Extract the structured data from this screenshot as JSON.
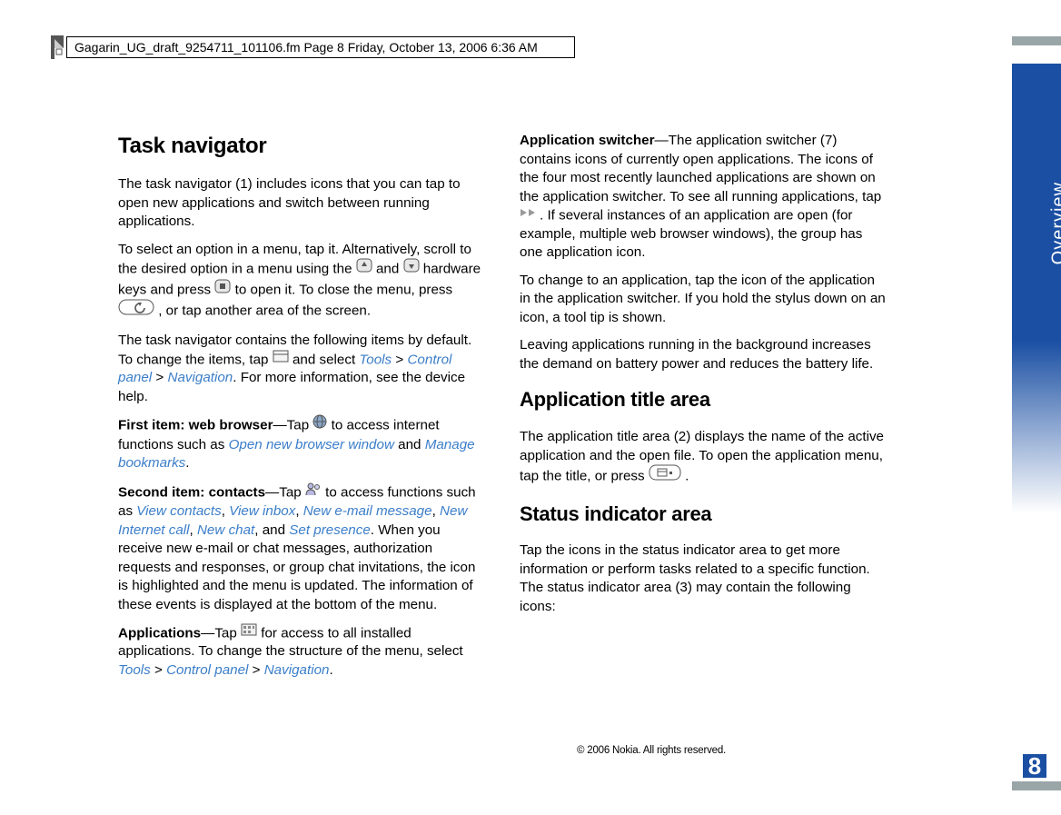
{
  "header": "Gagarin_UG_draft_9254711_101106.fm  Page 8  Friday, October 13, 2006  6:36 AM",
  "side_label": "Overview",
  "page_num": "8",
  "copyright": "© 2006 Nokia. All rights reserved.",
  "left": {
    "h_task_nav": "Task navigator",
    "p1": "The task navigator (1) includes icons that you can tap to open new applications and switch between running applications.",
    "p2a": "To select an option in a menu, tap it. Alternatively, scroll to the desired option in a menu using the ",
    "p2b": " and ",
    "p2c": " hardware keys and press ",
    "p2d": " to open it. To close the menu, press ",
    "p2e": " , or tap another area of the screen.",
    "p3a": "The task navigator contains the following items by default. To change the items, tap ",
    "p3b": " and select ",
    "tools1": "Tools",
    "gt": " > ",
    "cp": "Control panel",
    "nav": "Navigation",
    "p3c": ". For more information, see the device help.",
    "fi_label": "First item: web browser",
    "fi_a": "—Tap ",
    "fi_b": " to access internet functions such as ",
    "open_browser": "Open new browser window",
    "and1": " and ",
    "manage_bookmarks": "Manage bookmarks",
    "period": ".",
    "si_label": "Second item: contacts",
    "si_a": "—Tap ",
    "si_b": " to access functions such as ",
    "view_contacts": "View contacts",
    "comma": ", ",
    "view_inbox": "View inbox",
    "new_email": "New e-mail message",
    "new_call": "New Internet call",
    "new_chat": "New chat",
    "and2": ", and ",
    "set_presence": "Set presence",
    "si_c": ". When you receive new e-mail or chat messages, authorization requests and responses, or group chat invitations, the icon is highlighted and the menu is updated. The information of these events is displayed at the bottom of the menu.",
    "apps_label": "Applications",
    "apps_a": "—Tap ",
    "apps_b": " for access to all installed applications. To change the structure of the menu, select "
  },
  "right": {
    "as_label": "Application switcher",
    "as_a": "—The application switcher (7) contains icons of currently open applications. The icons of the four most recently launched applications are shown on the application switcher. To see all running applications, tap ",
    "as_b": ". If several instances of an application are open (for example, multiple web browser windows), the group has one application icon.",
    "p2": "To change to an application, tap the icon of the application in the application switcher. If you hold the stylus down on an icon, a tool tip is shown.",
    "p3": "Leaving applications running in the background increases the demand on battery power and reduces the battery life.",
    "h_title_area": "Application title area",
    "p4a": "The application title area (2) displays the name of the active application and the open file. To open the application menu, tap the title, or press ",
    "p4b": " .",
    "h_status": "Status indicator area",
    "p5": "Tap the icons in the status indicator area to get more information or perform tasks related to a specific function. The status indicator area (3) may contain the following icons:"
  }
}
